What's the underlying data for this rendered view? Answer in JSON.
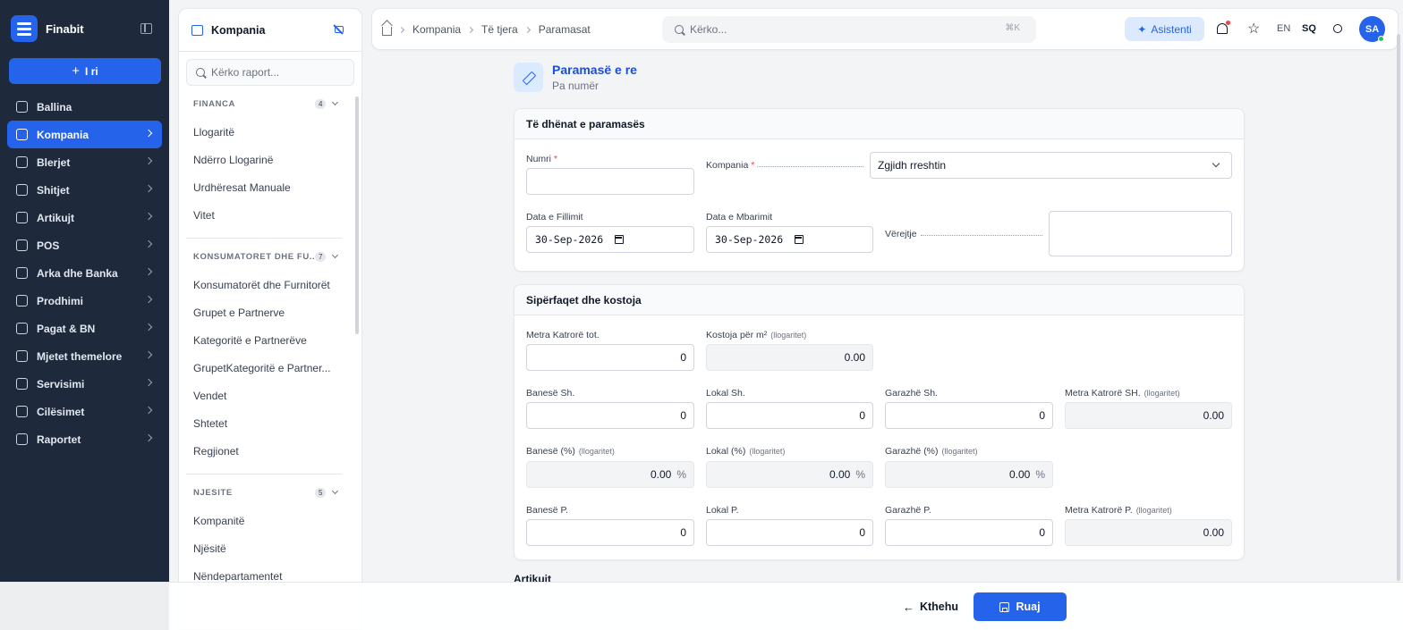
{
  "brand": {
    "name": "Finabit"
  },
  "sidebar": {
    "new_label": "I ri",
    "items": [
      {
        "label": "Ballina",
        "icon": "grid-icon",
        "active": false,
        "chevron": false
      },
      {
        "label": "Kompania",
        "icon": "building-icon",
        "active": true,
        "chevron": true
      },
      {
        "label": "Blerjet",
        "icon": "truck-icon",
        "active": false,
        "chevron": true
      },
      {
        "label": "Shitjet",
        "icon": "bag-icon",
        "active": false,
        "chevron": true
      },
      {
        "label": "Artikujt",
        "icon": "box-icon",
        "active": false,
        "chevron": true
      },
      {
        "label": "POS",
        "icon": "store-icon",
        "active": false,
        "chevron": true
      },
      {
        "label": "Arka dhe Banka",
        "icon": "wallet-icon",
        "active": false,
        "chevron": true
      },
      {
        "label": "Prodhimi",
        "icon": "factory-icon",
        "active": false,
        "chevron": true
      },
      {
        "label": "Pagat & BN",
        "icon": "coins-icon",
        "active": false,
        "chevron": true
      },
      {
        "label": "Mjetet themelore",
        "icon": "asset-icon",
        "active": false,
        "chevron": true
      },
      {
        "label": "Servisimi",
        "icon": "wrench-icon",
        "active": false,
        "chevron": true
      },
      {
        "label": "Cilësimet",
        "icon": "gear-icon",
        "active": false,
        "chevron": true
      },
      {
        "label": "Raportet",
        "icon": "bar-chart-icon",
        "active": false,
        "chevron": true
      }
    ]
  },
  "panel": {
    "title": "Kompania",
    "search_placeholder": "Kërko raport...",
    "groups": [
      {
        "title": "FINANCA",
        "count": "4",
        "items": [
          "Llogaritë",
          "Ndërro Llogarinë",
          "Urdhëresat Manuale",
          "Vitet"
        ]
      },
      {
        "title": "KONSUMATORET DHE FU...",
        "count": "7",
        "items": [
          "Konsumatorët dhe Furnitorët",
          "Grupet e Partnerve",
          "Kategoritë e Partnerëve",
          "GrupetKategoritë e Partner...",
          "Vendet",
          "Shtetet",
          "Regjionet"
        ]
      },
      {
        "title": "NJESITE",
        "count": "5",
        "items": [
          "Kompanitë",
          "Njësitë",
          "Nëndepartamentet"
        ]
      }
    ]
  },
  "topbar": {
    "breadcrumbs": [
      "Kompania",
      "Të tjera",
      "Paramasat"
    ],
    "search_placeholder": "Kërko...",
    "shortcut": "⌘K",
    "assistant_label": "Asistenti",
    "lang_en": "EN",
    "lang_sq": "SQ",
    "avatar_initials": "SA"
  },
  "form": {
    "title": "Paramasë e re",
    "subtitle": "Pa numër",
    "details": {
      "heading": "Të dhënat e paramasës",
      "numri_label": "Numri",
      "numri_value": "",
      "kompania_label": "Kompania",
      "kompania_value": "Zgjidh rreshtin",
      "data_fillimit_label": "Data e Fillimit",
      "data_fillimit_value": "30-Sep-2026",
      "data_mbarimit_label": "Data e Mbarimit",
      "data_mbarimit_value": "30-Sep-2026",
      "verejtje_label": "Vërejtje"
    },
    "areas": {
      "heading": "Sipërfaqet dhe kostoja",
      "calc_hint": "(llogaritet)",
      "metra_tot_label": "Metra Katrorë tot.",
      "metra_tot_value": "0",
      "kostoja_label": "Kostoja për m²",
      "kostoja_value": "0.00",
      "banese_sh_label": "Banesë Sh.",
      "banese_sh_value": "0",
      "lokal_sh_label": "Lokal Sh.",
      "lokal_sh_value": "0",
      "garazhe_sh_label": "Garazhë Sh.",
      "garazhe_sh_value": "0",
      "metra_sh_label": "Metra Katrorë SH.",
      "metra_sh_value": "0.00",
      "banese_pct_label": "Banesë (%)",
      "banese_pct_value": "0.00",
      "lokal_pct_label": "Lokal (%)",
      "lokal_pct_value": "0.00",
      "garazhe_pct_label": "Garazhë (%)",
      "garazhe_pct_value": "0.00",
      "pct_symbol": "%",
      "banese_p_label": "Banesë P.",
      "banese_p_value": "0",
      "lokal_p_label": "Lokal P.",
      "lokal_p_value": "0",
      "garazhe_p_label": "Garazhë P.",
      "garazhe_p_value": "0",
      "metra_p_label": "Metra Katrorë P.",
      "metra_p_value": "0.00"
    },
    "items_heading": "Artikujt"
  },
  "footer": {
    "back_label": "Kthehu",
    "save_label": "Ruaj"
  },
  "colors": {
    "accent": "#2563eb",
    "sidebar_bg": "#1e293b"
  }
}
